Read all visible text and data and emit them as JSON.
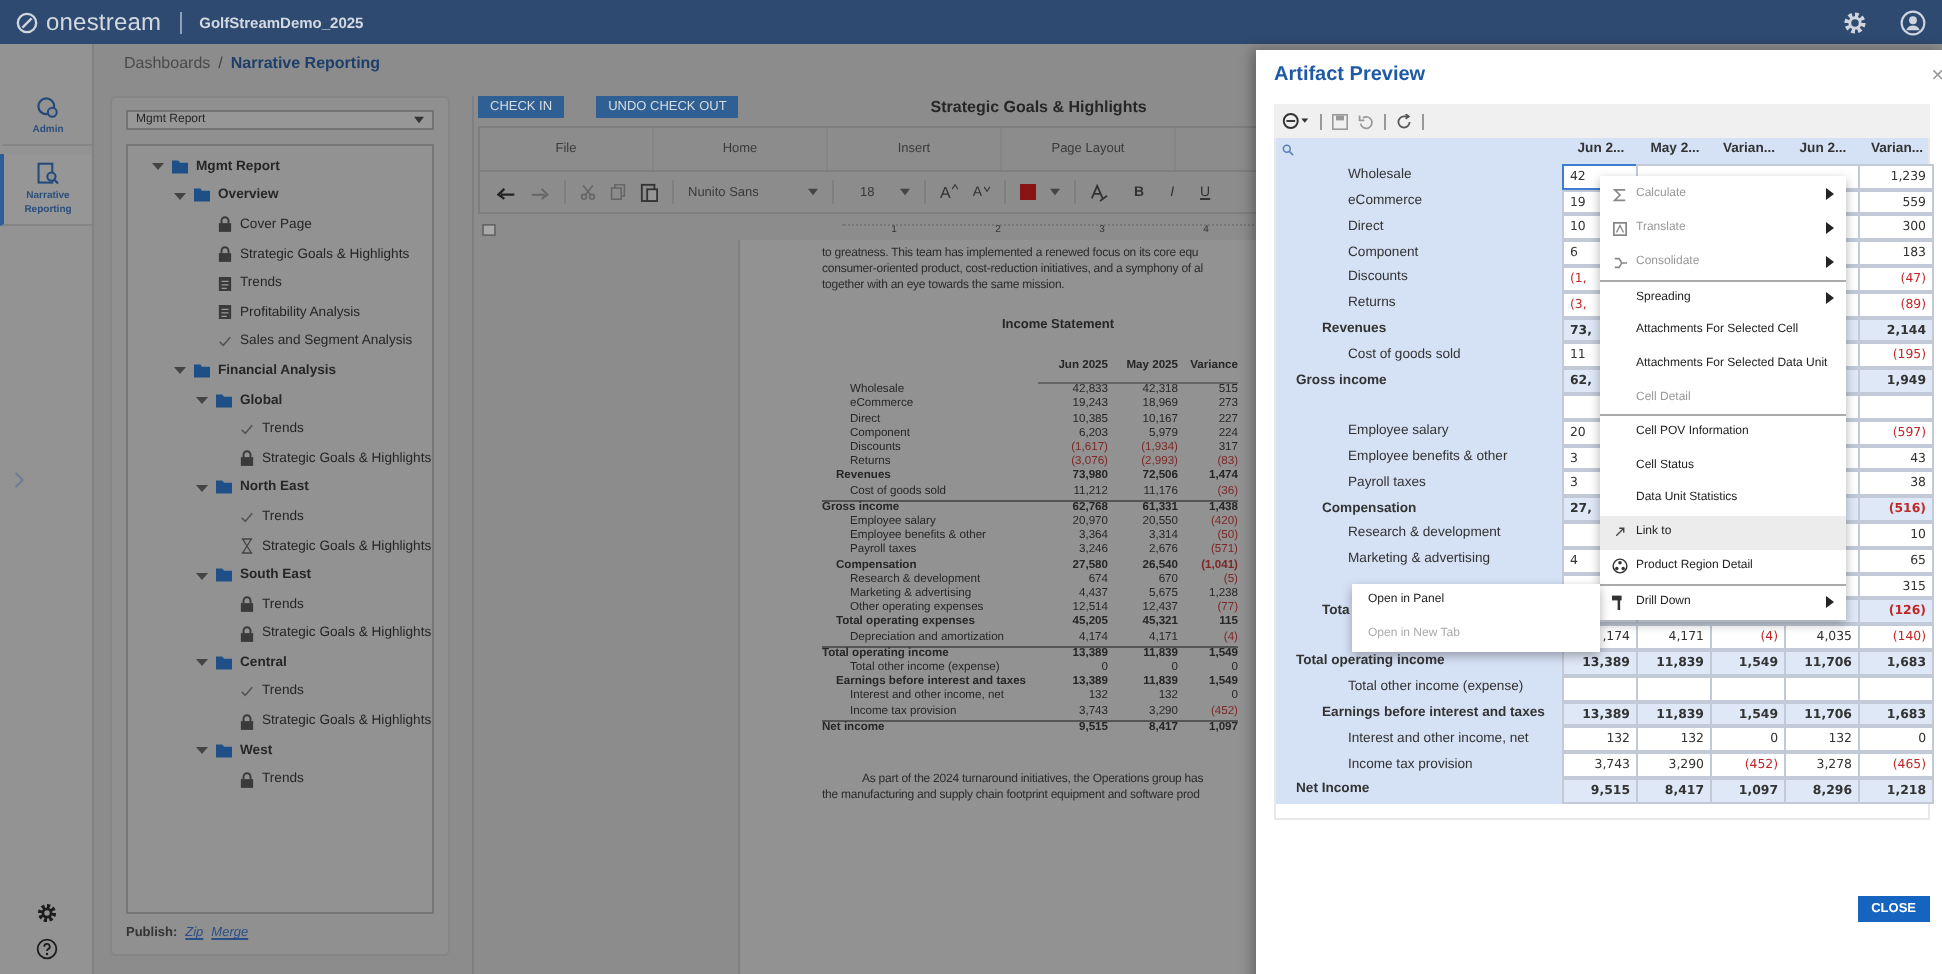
{
  "top_bar": {
    "brand": "onestream",
    "app": "GolfStreamDemo_2025"
  },
  "breadcrumb": {
    "separator": "/",
    "items": [
      {
        "label": "Dashboards",
        "current": false
      },
      {
        "label": "Narrative Reporting",
        "current": true
      }
    ]
  },
  "rail": {
    "items": [
      {
        "label": "Admin",
        "selected": false
      },
      {
        "label": "Narrative Reporting",
        "selected": true
      }
    ]
  },
  "tree_panel": {
    "report": "Mgmt Report",
    "publish_label": "Publish:",
    "publish_links": [
      "Zip",
      "Merge"
    ],
    "items": [
      {
        "kind": "folder",
        "label": "Mgmt Report",
        "expanded": true,
        "children": [
          {
            "kind": "folder",
            "label": "Overview",
            "expanded": true,
            "children": [
              {
                "kind": "locked",
                "label": "Cover Page"
              },
              {
                "kind": "locked",
                "label": "Strategic Goals & Highlights"
              },
              {
                "kind": "draft",
                "label": "Trends"
              },
              {
                "kind": "draft",
                "label": "Profitability Analysis"
              },
              {
                "kind": "approved",
                "label": "Sales and Segment Analysis"
              }
            ]
          },
          {
            "kind": "folder",
            "label": "Financial Analysis",
            "expanded": true,
            "children": [
              {
                "kind": "folder",
                "label": "Global",
                "expanded": true,
                "children": [
                  {
                    "kind": "approved",
                    "label": "Trends"
                  },
                  {
                    "kind": "locked",
                    "label": "Strategic Goals & Highlights"
                  }
                ]
              },
              {
                "kind": "folder",
                "label": "North East",
                "expanded": true,
                "children": [
                  {
                    "kind": "approved",
                    "label": "Trends"
                  },
                  {
                    "kind": "pending",
                    "label": "Strategic Goals & Highlights"
                  }
                ]
              },
              {
                "kind": "folder",
                "label": "South East",
                "expanded": true,
                "children": [
                  {
                    "kind": "locked",
                    "label": "Trends"
                  },
                  {
                    "kind": "locked",
                    "label": "Strategic Goals & Highlights"
                  }
                ]
              },
              {
                "kind": "folder",
                "label": "Central",
                "expanded": true,
                "children": [
                  {
                    "kind": "approved",
                    "label": "Trends"
                  },
                  {
                    "kind": "locked",
                    "label": "Strategic Goals & Highlights"
                  }
                ]
              },
              {
                "kind": "folder",
                "label": "West",
                "expanded": true,
                "children": [
                  {
                    "kind": "locked",
                    "label": "Trends"
                  }
                ]
              }
            ]
          }
        ]
      }
    ]
  },
  "document": {
    "buttons": [
      "CHECK IN",
      "UNDO CHECK OUT"
    ],
    "title": "Strategic Goals & Highlights",
    "ribbon_tabs": [
      "File",
      "Home",
      "Insert",
      "Page Layout"
    ],
    "toolbar": {
      "font": "Nunito Sans",
      "size": "18",
      "grow": "A",
      "shrink": "A",
      "bold": "B",
      "italic": "I",
      "underline": "U"
    },
    "ruler": [
      "1",
      "2",
      "3",
      "4"
    ],
    "paragraph_1": [
      "to greatness.  This team has implemented a renewed focus on its core equ",
      "consumer-oriented product, cost-reduction initiatives, and a symphony of al",
      "together with an eye towards the same mission."
    ],
    "statement": {
      "title": "Income Statement",
      "columns": [
        "Jun 2025",
        "May 2025",
        "Variance"
      ],
      "rows": [
        {
          "label": "Wholesale",
          "kind": "detail",
          "values": [
            "42,833",
            "42,318",
            "515"
          ]
        },
        {
          "label": "eCommerce",
          "kind": "detail",
          "values": [
            "19,243",
            "18,969",
            "273"
          ]
        },
        {
          "label": "Direct",
          "kind": "detail",
          "values": [
            "10,385",
            "10,167",
            "227"
          ]
        },
        {
          "label": "Component",
          "kind": "detail",
          "values": [
            "6,203",
            "5,979",
            "224"
          ]
        },
        {
          "label": "Discounts",
          "kind": "detail",
          "values": [
            {
              "text": "(1,617)",
              "negative": true
            },
            {
              "text": "(1,934)",
              "negative": true
            },
            "317"
          ]
        },
        {
          "label": "Returns",
          "kind": "detail",
          "values": [
            {
              "text": "(3,076)",
              "negative": true
            },
            {
              "text": "(2,993)",
              "negative": true
            },
            {
              "text": "(83)",
              "negative": true
            }
          ]
        },
        {
          "label": "Revenues",
          "kind": "subtotal",
          "values": [
            "73,980",
            "72,506",
            "1,474"
          ]
        },
        {
          "label": "Cost of goods sold",
          "kind": "detail",
          "values": [
            "11,212",
            "11,176",
            {
              "text": "(36)",
              "negative": true
            }
          ]
        },
        {
          "label": "Gross income",
          "kind": "total",
          "values": [
            "62,768",
            "61,331",
            "1,438"
          ]
        },
        {
          "label": "Employee salary",
          "kind": "detail",
          "values": [
            "20,970",
            "20,550",
            {
              "text": "(420)",
              "negative": true
            }
          ]
        },
        {
          "label": "Employee benefits & other",
          "kind": "detail",
          "values": [
            "3,364",
            "3,314",
            {
              "text": "(50)",
              "negative": true
            }
          ]
        },
        {
          "label": "Payroll taxes",
          "kind": "detail",
          "values": [
            "3,246",
            "2,676",
            {
              "text": "(571)",
              "negative": true
            }
          ]
        },
        {
          "label": "Compensation",
          "kind": "subtotal",
          "values": [
            "27,580",
            "26,540",
            {
              "text": "(1,041)",
              "negative": true
            }
          ]
        },
        {
          "label": "Research & development",
          "kind": "detail",
          "values": [
            "674",
            "670",
            {
              "text": "(5)",
              "negative": true
            }
          ]
        },
        {
          "label": "Marketing & advertising",
          "kind": "detail",
          "values": [
            "4,437",
            "5,675",
            "1,238"
          ]
        },
        {
          "label": "Other operating expenses",
          "kind": "detail",
          "values": [
            "12,514",
            "12,437",
            {
              "text": "(77)",
              "negative": true
            }
          ]
        },
        {
          "label": "Total operating expenses",
          "kind": "subtotal",
          "values": [
            "45,205",
            "45,321",
            "115"
          ]
        },
        {
          "label": "Depreciation and amortization",
          "kind": "detail",
          "values": [
            "4,174",
            "4,171",
            {
              "text": "(4)",
              "negative": true
            }
          ]
        },
        {
          "label": "Total operating income",
          "kind": "total",
          "values": [
            "13,389",
            "11,839",
            "1,549"
          ]
        },
        {
          "label": "Total other income (expense)",
          "kind": "detail",
          "values": [
            "0",
            "0",
            "0"
          ]
        },
        {
          "label": "Earnings before interest and taxes",
          "kind": "subtotal",
          "values": [
            "13,389",
            "11,839",
            "1,549"
          ]
        },
        {
          "label": "Interest and other income, net",
          "kind": "detail",
          "values": [
            "132",
            "132",
            "0"
          ]
        },
        {
          "label": "Income tax provision",
          "kind": "detail",
          "values": [
            "3,743",
            "3,290",
            {
              "text": "(452)",
              "negative": true
            }
          ]
        },
        {
          "label": "Net income",
          "kind": "total",
          "values": [
            "9,515",
            "8,417",
            "1,097"
          ]
        }
      ]
    },
    "paragraph_2": [
      "As part of the 2024 turnaround initiatives, the Operations group has",
      "the manufacturing and supply chain footprint equipment and software prod"
    ]
  },
  "dialog": {
    "title": "Artifact Preview",
    "close_glyph": "×",
    "close_button": "CLOSE",
    "grid": {
      "columns": [
        "Jun 2...",
        "May 2...",
        "Varian...",
        "Jun 2...",
        "Varian..."
      ],
      "rows": [
        {
          "label": "Wholesale",
          "kind": "detail",
          "first_value": {
            "text": "42",
            "selected": true
          },
          "last_value": "1,239"
        },
        {
          "label": "eCommerce",
          "kind": "detail",
          "first_value": "19",
          "last_value": "559"
        },
        {
          "label": "Direct",
          "kind": "detail",
          "first_value": "10",
          "last_value": "300"
        },
        {
          "label": "Component",
          "kind": "detail",
          "first_value": "6",
          "last_value": "183"
        },
        {
          "label": "Discounts",
          "kind": "detail",
          "first_value": {
            "text": "(1,",
            "negative": true
          },
          "last_value": {
            "text": "(47)",
            "negative": true
          }
        },
        {
          "label": "Returns",
          "kind": "detail",
          "first_value": {
            "text": "(3,",
            "negative": true
          },
          "last_value": {
            "text": "(89)",
            "negative": true
          }
        },
        {
          "label": "Revenues",
          "kind": "subtotal",
          "first_value": "73,",
          "last_value": "2,144"
        },
        {
          "label": "Cost of goods sold",
          "kind": "detail",
          "first_value": "11",
          "last_value": {
            "text": "(195)",
            "negative": true
          }
        },
        {
          "label": "Gross income",
          "kind": "total",
          "first_value": "62,",
          "last_value": "1,949"
        },
        {
          "kind": "detail"
        },
        {
          "label": "Employee salary",
          "kind": "detail",
          "first_value": "20",
          "last_value": {
            "text": "(597)",
            "negative": true
          }
        },
        {
          "label": "Employee benefits & other",
          "kind": "detail",
          "first_value": "3",
          "last_value": "43"
        },
        {
          "label": "Payroll taxes",
          "kind": "detail",
          "first_value": "3",
          "last_value": "38"
        },
        {
          "label": "Compensation",
          "kind": "subtotal",
          "first_value": "27,",
          "last_value": {
            "text": "(516)",
            "negative": true
          }
        },
        {
          "label": "Research & development",
          "kind": "detail",
          "last_value": "10"
        },
        {
          "label": "Marketing & advertising",
          "kind": "detail",
          "first_value": "4",
          "last_value": "65"
        },
        {
          "kind": "detail",
          "last_value": "315"
        },
        {
          "label": "Tota",
          "kind": "subtotal",
          "last_value": {
            "text": "(126)",
            "negative": true
          }
        },
        {
          "kind": "detail",
          "values": [
            ",174",
            "4,171",
            {
              "text": "(4)",
              "negative": true
            },
            "4,035",
            {
              "text": "(140)",
              "negative": true
            }
          ]
        },
        {
          "label": "Total operating income",
          "kind": "total",
          "values": [
            "13,389",
            "11,839",
            "1,549",
            "11,706",
            "1,683"
          ]
        },
        {
          "label": "Total other income (expense)",
          "kind": "detail"
        },
        {
          "label": "Earnings before interest and taxes",
          "kind": "subtotal",
          "values": [
            "13,389",
            "11,839",
            "1,549",
            "11,706",
            "1,683"
          ]
        },
        {
          "label": "Interest and other income, net",
          "kind": "detail",
          "values": [
            "132",
            "132",
            "0",
            "132",
            "0"
          ]
        },
        {
          "label": "Income tax provision",
          "kind": "detail",
          "values": [
            "3,743",
            "3,290",
            {
              "text": "(452)",
              "negative": true
            },
            "3,278",
            {
              "text": "(465)",
              "negative": true
            }
          ]
        },
        {
          "label": "Net Income",
          "kind": "total",
          "values": [
            "9,515",
            "8,417",
            "1,097",
            "8,296",
            "1,218"
          ]
        }
      ]
    },
    "context_menu": [
      {
        "label": "Calculate",
        "disabled": true,
        "submenu": true,
        "divider_above": false,
        "highlighted": false
      },
      {
        "label": "Translate",
        "disabled": true,
        "submenu": true,
        "divider_above": false,
        "highlighted": false
      },
      {
        "label": "Consolidate",
        "disabled": true,
        "submenu": true,
        "divider_above": false,
        "highlighted": false
      },
      {
        "label": "Spreading",
        "disabled": false,
        "submenu": true,
        "divider_above": true,
        "highlighted": false
      },
      {
        "label": "Attachments For Selected Cell",
        "disabled": false,
        "submenu": false,
        "divider_above": false,
        "highlighted": false
      },
      {
        "label": "Attachments For Selected Data Unit",
        "disabled": false,
        "submenu": false,
        "divider_above": false,
        "highlighted": false
      },
      {
        "label": "Cell Detail",
        "disabled": true,
        "submenu": false,
        "divider_above": false,
        "highlighted": false
      },
      {
        "label": "Cell POV Information",
        "disabled": false,
        "submenu": false,
        "divider_above": true,
        "highlighted": false
      },
      {
        "label": "Cell Status",
        "disabled": false,
        "submenu": false,
        "divider_above": false,
        "highlighted": false
      },
      {
        "label": "Data Unit Statistics",
        "disabled": false,
        "submenu": false,
        "divider_above": false,
        "highlighted": false
      },
      {
        "label": "Link to",
        "disabled": false,
        "submenu": false,
        "divider_above": false,
        "highlighted": true
      },
      {
        "label": "Product Region Detail",
        "disabled": false,
        "submenu": false,
        "divider_above": false,
        "highlighted": false
      },
      {
        "label": "Drill Down",
        "disabled": false,
        "submenu": true,
        "divider_above": true,
        "highlighted": false
      }
    ],
    "submenu": [
      {
        "label": "Open in Panel",
        "disabled": false
      },
      {
        "label": "Open in New Tab",
        "disabled": true
      }
    ]
  }
}
